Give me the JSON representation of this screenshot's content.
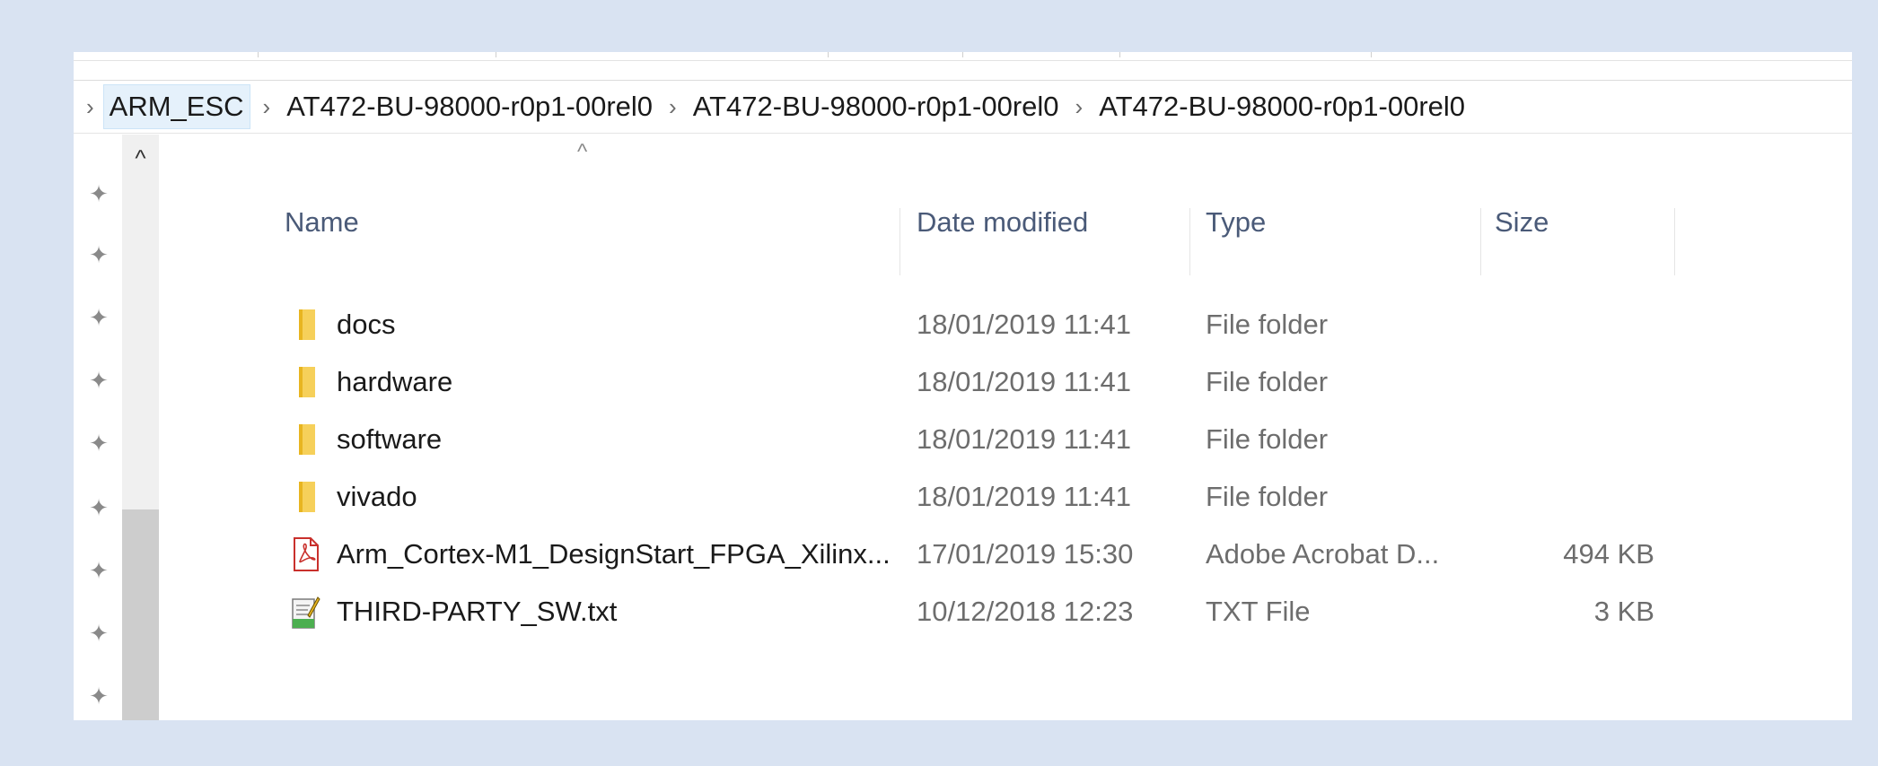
{
  "breadcrumb": {
    "items": [
      "ARM_ESC",
      "AT472-BU-98000-r0p1-00rel0",
      "AT472-BU-98000-r0p1-00rel0",
      "AT472-BU-98000-r0p1-00rel0"
    ]
  },
  "columns": {
    "name": "Name",
    "date": "Date modified",
    "type": "Type",
    "size": "Size"
  },
  "files": [
    {
      "name": "docs",
      "date": "18/01/2019 11:41",
      "type": "File folder",
      "size": "",
      "icon": "folder-icon"
    },
    {
      "name": "hardware",
      "date": "18/01/2019 11:41",
      "type": "File folder",
      "size": "",
      "icon": "folder-icon"
    },
    {
      "name": "software",
      "date": "18/01/2019 11:41",
      "type": "File folder",
      "size": "",
      "icon": "folder-icon"
    },
    {
      "name": "vivado",
      "date": "18/01/2019 11:41",
      "type": "File folder",
      "size": "",
      "icon": "folder-icon"
    },
    {
      "name": "Arm_Cortex-M1_DesignStart_FPGA_Xilinx...",
      "date": "17/01/2019 15:30",
      "type": "Adobe Acrobat D...",
      "size": "494 KB",
      "icon": "pdf-icon"
    },
    {
      "name": "THIRD-PARTY_SW.txt",
      "date": "10/12/2018 12:23",
      "type": "TXT File",
      "size": "3 KB",
      "icon": "text-file-icon"
    }
  ],
  "colors": {
    "background": "#d9e3f2",
    "folder": "#f0c330",
    "header_text": "#4a5a78"
  }
}
